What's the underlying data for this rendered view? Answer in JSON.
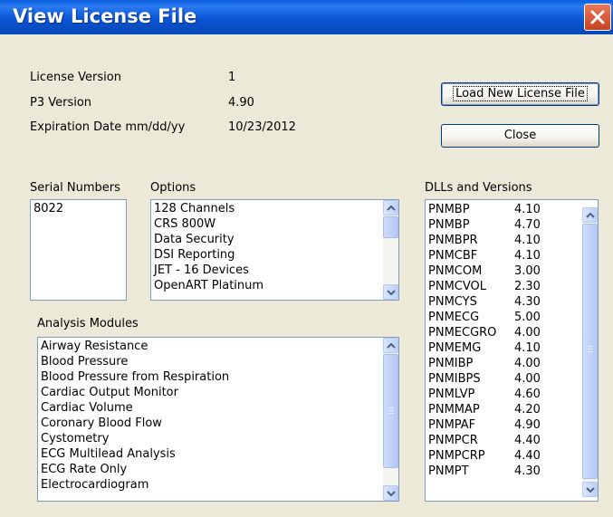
{
  "window": {
    "title": "View License File"
  },
  "info": {
    "license_version_label": "License Version",
    "license_version_value": "1",
    "p3_version_label": "P3 Version",
    "p3_version_value": "4.90",
    "expiration_label": "Expiration Date mm/dd/yy",
    "expiration_value": "10/23/2012"
  },
  "buttons": {
    "load_label": "Load New License File",
    "close_label": "Close"
  },
  "serial_numbers": {
    "label": "Serial Numbers",
    "items": [
      "8022"
    ]
  },
  "options": {
    "label": "Options",
    "items": [
      "128 Channels",
      "CRS 800W",
      "Data Security",
      "DSI Reporting",
      "JET - 16 Devices",
      "OpenART Platinum"
    ]
  },
  "analysis_modules": {
    "label": "Analysis Modules",
    "items": [
      "Airway Resistance",
      "Blood Pressure",
      "Blood Pressure from Respiration",
      "Cardiac Output Monitor",
      "Cardiac Volume",
      "Coronary Blood Flow",
      "Cystometry",
      "ECG Multilead Analysis",
      "ECG Rate Only",
      "Electrocardiogram"
    ]
  },
  "dlls": {
    "label": "DLLs and Versions",
    "items": [
      {
        "name": "PNMBP",
        "version": "4.10"
      },
      {
        "name": "PNMBP",
        "version": "4.70"
      },
      {
        "name": "PNMBPR",
        "version": "4.10"
      },
      {
        "name": "PNMCBF",
        "version": "4.10"
      },
      {
        "name": "PNMCOM",
        "version": "3.00"
      },
      {
        "name": "PNMCVOL",
        "version": "2.30"
      },
      {
        "name": "PNMCYS",
        "version": "4.30"
      },
      {
        "name": "PNMECG",
        "version": "5.00"
      },
      {
        "name": "PNMECGRO",
        "version": "4.00"
      },
      {
        "name": "PNMEMG",
        "version": "4.10"
      },
      {
        "name": "PNMIBP",
        "version": "4.00"
      },
      {
        "name": "PNMIBPS",
        "version": "4.00"
      },
      {
        "name": "PNMLVP",
        "version": "4.60"
      },
      {
        "name": "PNMMAP",
        "version": "4.20"
      },
      {
        "name": "PNMPAF",
        "version": "4.90"
      },
      {
        "name": "PNMPCR",
        "version": "4.40"
      },
      {
        "name": "PNMPCRP",
        "version": "4.40"
      },
      {
        "name": "PNMPT",
        "version": "4.30"
      }
    ]
  },
  "icons": {
    "close": "close-x-icon",
    "scroll_up": "scroll-up-arrow-icon",
    "scroll_down": "scroll-down-arrow-icon"
  },
  "colors": {
    "titlebar": "#0b55d6",
    "dialog_bg": "#ece9d8",
    "close_button": "#c8401f"
  }
}
